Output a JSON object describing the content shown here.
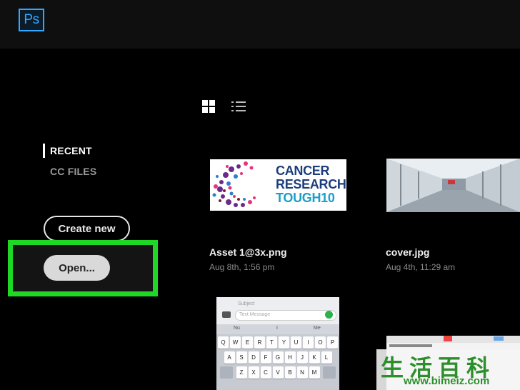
{
  "app": {
    "logo_text": "Ps"
  },
  "view_toggle": {
    "grid_icon": "grid-view-icon",
    "list_icon": "list-view-icon",
    "active": "grid"
  },
  "nav": [
    {
      "label": "RECENT",
      "active": true
    },
    {
      "label": "CC FILES",
      "active": false
    }
  ],
  "buttons": {
    "create_new": "Create new",
    "open": "Open..."
  },
  "highlight_color": "#1fd826",
  "files": [
    {
      "name": "Asset 1@3x.png",
      "date": "Aug 8th, 1:56 pm"
    },
    {
      "name": "cover.jpg",
      "date": "Aug 4th, 11:29 am"
    }
  ],
  "thumbnail_text": {
    "cancer_research": [
      "CANCER",
      "RESEARCH",
      "TOUGH10"
    ],
    "keyboard": {
      "subject": "Subject",
      "message": "Text Message",
      "suggestions": [
        "Nu",
        "I",
        "Me"
      ],
      "rows": [
        [
          "Q",
          "W",
          "E",
          "R",
          "T",
          "Y",
          "U",
          "I",
          "O",
          "P"
        ],
        [
          "A",
          "S",
          "D",
          "F",
          "G",
          "H",
          "J",
          "K",
          "L"
        ],
        [
          "Z",
          "X",
          "C",
          "V",
          "B",
          "N",
          "M"
        ]
      ]
    }
  },
  "watermark": {
    "chars": "生活百科",
    "url": "www.bimeiz.com"
  }
}
